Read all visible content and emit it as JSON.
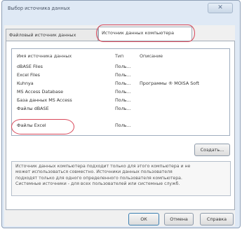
{
  "window": {
    "title": "Выбор источника данных"
  },
  "tabs": [
    {
      "label": "Файловый источник данных"
    },
    {
      "label": "Источник данных компьютера"
    }
  ],
  "list": {
    "columns": [
      "Имя источника данных",
      "Тип",
      "Описание"
    ],
    "rows": [
      {
        "name": "dBASE Files",
        "type": "Поль...",
        "desc": ""
      },
      {
        "name": "Excel Files",
        "type": "Поль...",
        "desc": ""
      },
      {
        "name": "Kuhnya",
        "type": "Поль...",
        "desc": "Программы ® MOISA Soft"
      },
      {
        "name": "MS Access Database",
        "type": "Поль...",
        "desc": ""
      },
      {
        "name": "База данных MS Access",
        "type": "Поль...",
        "desc": ""
      },
      {
        "name": "Файлы dBASE",
        "type": "Поль...",
        "desc": ""
      },
      {
        "name": "Файлы Excel",
        "type": "Поль...",
        "desc": ""
      }
    ],
    "highlighted_row": 6
  },
  "buttons": {
    "create": "Создать...",
    "ok": "ОК",
    "cancel": "Отмена",
    "help": "Справка"
  },
  "info_text": [
    "Источник данных компьютера подходит только для этого компьютера и не",
    "может использоваться совместно. Источники данных пользователя",
    "подходят только для одного определенного пользователя компьютера.",
    "Системные источники - для всех пользователей или системные служб."
  ],
  "colors": {
    "highlight": "#d9485a",
    "window_frame": "#dfe9f5"
  }
}
